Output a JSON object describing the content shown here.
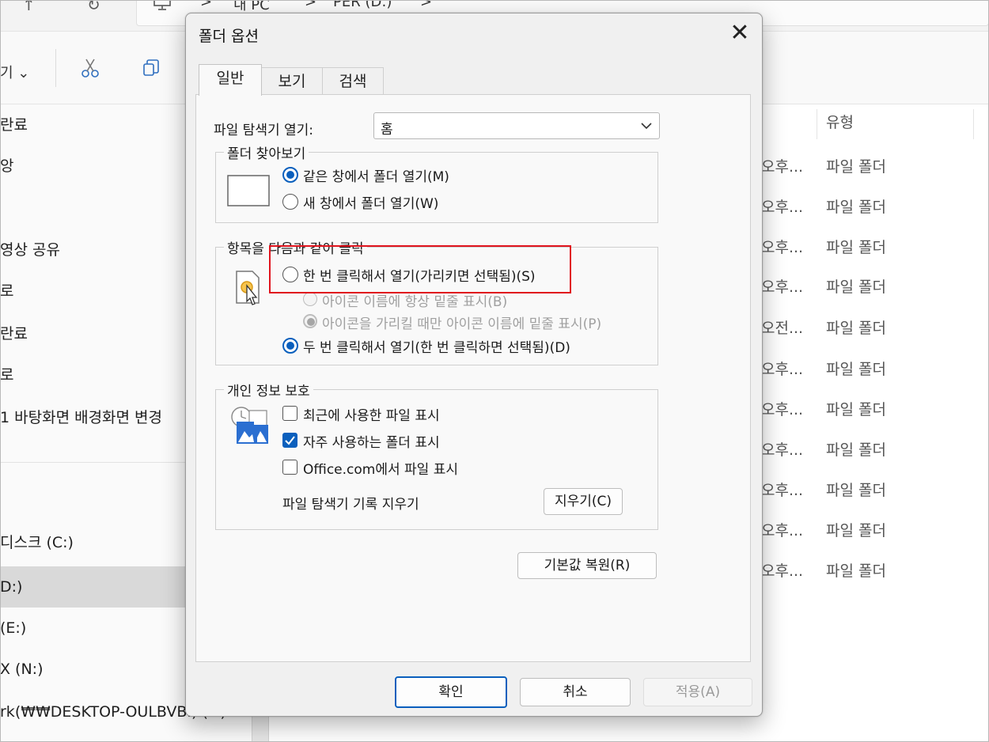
{
  "explorer": {
    "address": {
      "part1": "내 PC",
      "part2": "PER (D:)",
      "sep": ">"
    },
    "toolbar": {
      "view_label": "기 ⌄"
    },
    "sidebar": [
      {
        "label": "란료"
      },
      {
        "label": "앙"
      },
      {
        "label": ""
      },
      {
        "label": "영상 공유"
      },
      {
        "label": "로"
      },
      {
        "label": "란료"
      },
      {
        "label": "로"
      },
      {
        "label": "1 바탕화면 배경화면 변경"
      },
      {
        "label": ""
      },
      {
        "label": "디스크 (C:)"
      },
      {
        "label": "D:)"
      },
      {
        "label": "(E:)"
      },
      {
        "label": "X (N:)"
      },
      {
        "label": "rk(₩₩DESKTOP-OULBVBI) (Y:)"
      }
    ],
    "column_type": "유형",
    "rows": [
      {
        "date": "오후...",
        "type": "파일 폴더"
      },
      {
        "date": "오후...",
        "type": "파일 폴더"
      },
      {
        "date": "오후...",
        "type": "파일 폴더"
      },
      {
        "date": "오후...",
        "type": "파일 폴더"
      },
      {
        "date": "오전...",
        "type": "파일 폴더"
      },
      {
        "date": "오후...",
        "type": "파일 폴더"
      },
      {
        "date": "오후...",
        "type": "파일 폴더"
      },
      {
        "date": "오후...",
        "type": "파일 폴더"
      },
      {
        "date": "오후...",
        "type": "파일 폴더"
      },
      {
        "date": "오후...",
        "type": "파일 폴더"
      },
      {
        "date": "오후...",
        "type": "파일 폴더"
      }
    ]
  },
  "dialog": {
    "title": "폴더 옵션",
    "close_glyph": "✕",
    "tabs": [
      {
        "label": "일반",
        "active": true
      },
      {
        "label": "보기",
        "active": false
      },
      {
        "label": "검색",
        "active": false
      }
    ],
    "open_explorer": {
      "label": "파일 탐색기 열기:",
      "value": "홈"
    },
    "browse_folders": {
      "legend": "폴더 찾아보기",
      "options": [
        {
          "label": "같은 창에서 폴더 열기(M)",
          "selected": true
        },
        {
          "label": "새 창에서 폴더 열기(W)",
          "selected": false
        }
      ]
    },
    "click_items": {
      "legend": "항목을 다음과 같이 클릭",
      "single_click": {
        "label": "한 번 클릭해서 열기(가리키면 선택됨)(S)",
        "selected": false
      },
      "underline_always": {
        "label": "아이콘 이름에 항상 밑줄 표시(B)",
        "selected": false,
        "disabled": true
      },
      "underline_hover": {
        "label": "아이콘을 가리킬 때만 아이콘 이름에 밑줄 표시(P)",
        "selected": true,
        "disabled": true
      },
      "double_click": {
        "label": "두 번 클릭해서 열기(한 번 클릭하면 선택됨)(D)",
        "selected": true
      }
    },
    "privacy": {
      "legend": "개인 정보 보호",
      "checks": [
        {
          "label": "최근에 사용한 파일 표시",
          "checked": false
        },
        {
          "label": "자주 사용하는 폴더 표시",
          "checked": true
        },
        {
          "label": "Office.com에서 파일 표시",
          "checked": false
        }
      ],
      "clear_label": "파일 탐색기 기록 지우기",
      "clear_button": "지우기(C)"
    },
    "restore_button": "기본값 복원(R)",
    "footer": {
      "ok": "확인",
      "cancel": "취소",
      "apply": "적용(A)"
    }
  },
  "colors": {
    "accent": "#0a5fbd",
    "highlight": "#e0141e"
  }
}
